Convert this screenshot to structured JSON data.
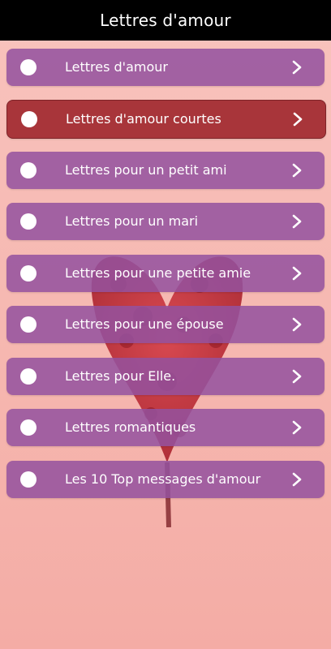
{
  "app_bar": {
    "title": "Lettres d'amour"
  },
  "colors": {
    "item_bg": "#94529e",
    "item_active_bg": "#a8353a",
    "app_bar_bg": "#000000",
    "background": "#f8c3bd"
  },
  "menu": {
    "items": [
      {
        "label": "Lettres d'amour",
        "active": false
      },
      {
        "label": "Lettres d'amour courtes",
        "active": true
      },
      {
        "label": "Lettres pour un petit ami",
        "active": false
      },
      {
        "label": "Lettres pour un mari",
        "active": false
      },
      {
        "label": "Lettres pour une petite amie",
        "active": false
      },
      {
        "label": "Lettres pour une épouse",
        "active": false
      },
      {
        "label": "Lettres pour Elle.",
        "active": false
      },
      {
        "label": "Lettres romantiques",
        "active": false
      },
      {
        "label": "Les 10 Top messages d'amour",
        "active": false
      }
    ],
    "bullet_icon": "circle-icon",
    "arrow_icon": "chevron-right-icon"
  },
  "background_image": "rose-heart"
}
